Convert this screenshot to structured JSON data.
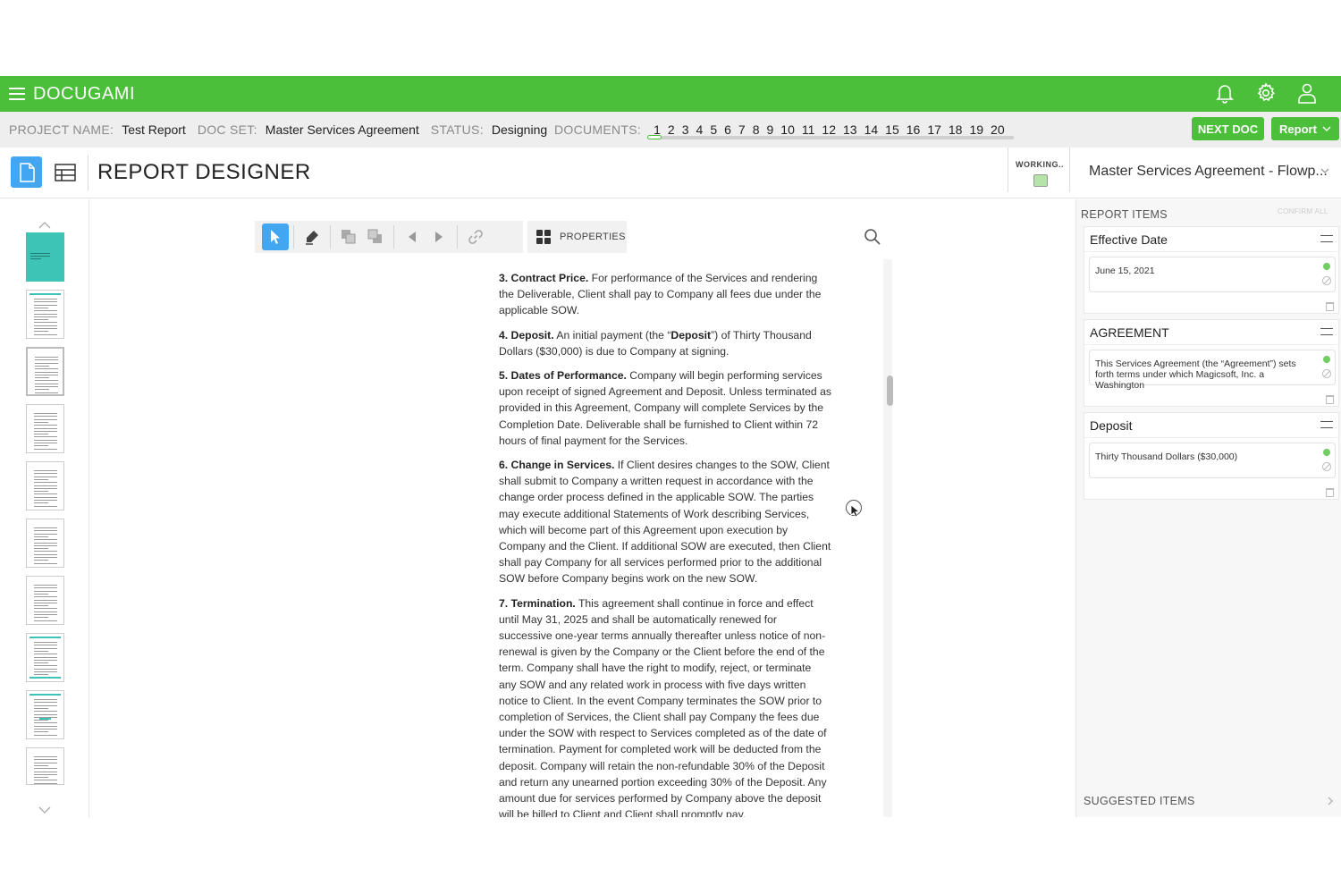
{
  "app": {
    "brand": "DOCUGAMI"
  },
  "project": {
    "project_name_label": "PROJECT NAME:",
    "project_name": "Test Report",
    "doc_set_label": "DOC SET:",
    "doc_set": "Master Services Agreement",
    "status_label": "STATUS:",
    "status": "Designing",
    "documents_label": "DOCUMENTS:",
    "documents": [
      "1",
      "2",
      "3",
      "4",
      "5",
      "6",
      "7",
      "8",
      "9",
      "10",
      "11",
      "12",
      "13",
      "14",
      "15",
      "16",
      "17",
      "18",
      "19",
      "20"
    ],
    "next_doc_label": "NEXT DOC",
    "report_label": "Report"
  },
  "designer": {
    "title": "REPORT DESIGNER",
    "working_label": "WORKING..",
    "selected_document": "Master Services Agreement - Flowp..."
  },
  "toolbar": {
    "properties_label": "PROPERTIES"
  },
  "document": {
    "paragraphs": [
      {
        "heading": "3. Contract Price.",
        "body": " For performance of the Services and rendering the Deliverable, Client shall pay to Company all fees due under the applicable SOW."
      },
      {
        "heading": "4. Deposit.",
        "body_pre": " An initial payment (the “",
        "bold_inline": "Deposit",
        "body_post": "”) of Thirty Thousand Dollars ($30,000) is due to Company at signing."
      },
      {
        "heading": "5. Dates of Performance.",
        "body": " Company will begin performing services upon receipt of signed Agreement and Deposit. Unless terminated as provided in this Agreement, Company will complete Services by the Completion Date. Deliverable shall be furnished to Client within 72 hours of final payment for the Services."
      },
      {
        "heading": "6. Change in Services.",
        "body": " If Client desires changes to the SOW, Client shall submit to Company a written request in accordance with the change order process defined in the applicable SOW. The parties may execute additional Statements of Work describing Services, which will become part of this Agreement upon execution by Company and the Client. If additional SOW are executed, then Client shall pay Company for all services performed prior to the additional SOW before Company begins work on the new SOW."
      },
      {
        "heading": "7. Termination.",
        "body": " This agreement shall continue in force and effect until May 31, 2025 and shall be automatically renewed for successive one-year terms annually thereafter unless notice of non-renewal is given by the Company or the Client before the end of the term. Company shall have the right to modify, reject, or terminate any SOW and any related work in process with five days written notice to Client. In the event Company terminates the SOW prior to completion of Services, the Client shall pay Company the fees due under the SOW with respect to Services completed as of the date of termination. Payment for completed work will be deducted from the deposit. Company will retain the non-refundable 30% of the Deposit and return any unearned portion exceeding 30% of the Deposit. Any amount due for services performed by Company above the deposit will be billed to Client and Client shall promptly pay."
      }
    ]
  },
  "report_items": {
    "title": "REPORT ITEMS",
    "confirm_all_label": "CONFIRM ALL",
    "items": [
      {
        "name": "Effective Date",
        "value": "June 15, 2021"
      },
      {
        "name": "AGREEMENT",
        "value": "This Services Agreement (the “Agreement”) sets forth terms under which Magicsoft, Inc. a Washington"
      },
      {
        "name": "Deposit",
        "value": "Thirty Thousand Dollars ($30,000)"
      }
    ],
    "suggested_label": "SUGGESTED ITEMS"
  },
  "colors": {
    "brand_green": "#4cbf3a",
    "accent_blue": "#43a6f0",
    "cover_teal": "#3dc4b6"
  }
}
